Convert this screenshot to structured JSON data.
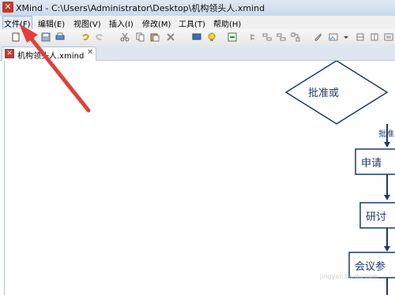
{
  "window": {
    "title": "XMind - C:\\Users\\Administrator\\Desktop\\机构领头人.xmind"
  },
  "menu": [
    "文件(F)",
    "编辑(E)",
    "视图(V)",
    "插入(I)",
    "修改(M)",
    "工具(T)",
    "帮助(H)"
  ],
  "toolbar_icons": [
    "new-icon",
    "open-icon",
    "save-icon",
    "print-icon",
    "undo-icon",
    "redo-icon",
    "cut-icon",
    "copy-icon",
    "paste-icon",
    "delete-icon",
    "comment-icon",
    "idea-icon",
    "export-icon",
    "topic-icon",
    "subtopic-icon",
    "floating-icon",
    "relationship-icon",
    "attach-icon",
    "image-icon",
    "structure-icon",
    "more-icon"
  ],
  "tab": {
    "label": "机构领头人.xmind",
    "close": "✕"
  },
  "diagram": {
    "decision": "批准或",
    "edge_label": "批准",
    "node1": "申请",
    "node2": "研讨",
    "node3": "会议参"
  },
  "watermark": "jingyan.baidu.com",
  "colors": {
    "node_border": "#1a3a6b",
    "arrow": "#1a3a6b",
    "annotation_arrow": "#e0403a"
  }
}
